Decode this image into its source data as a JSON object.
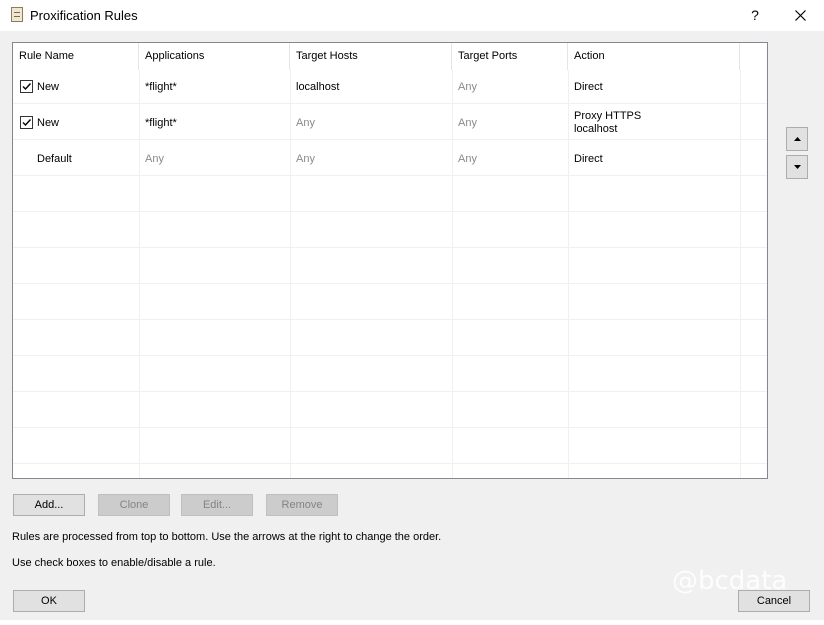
{
  "window": {
    "title": "Proxification Rules",
    "help_label": "?",
    "close_icon": "close-icon"
  },
  "table": {
    "columns": [
      "Rule Name",
      "Applications",
      "Target Hosts",
      "Target Ports",
      "Action"
    ],
    "rows": [
      {
        "checked": true,
        "name": "New",
        "applications": "*flight*",
        "target_hosts": "localhost",
        "target_ports": "Any",
        "action_line1": "Direct",
        "action_line2": ""
      },
      {
        "checked": true,
        "name": "New",
        "applications": "*flight*",
        "target_hosts": "Any",
        "target_ports": "Any",
        "action_line1": "Proxy HTTPS",
        "action_line2": "localhost"
      },
      {
        "checked": null,
        "name": "Default",
        "applications": "Any",
        "target_hosts": "Any",
        "target_ports": "Any",
        "action_line1": "Direct",
        "action_line2": ""
      }
    ]
  },
  "side_buttons": {
    "up_icon": "arrow-up-icon",
    "down_icon": "arrow-down-icon"
  },
  "buttons": {
    "add": "Add...",
    "clone": "Clone",
    "edit": "Edit...",
    "remove": "Remove",
    "ok": "OK",
    "cancel": "Cancel"
  },
  "notes": {
    "order": "Rules are processed from top to bottom. Use the arrows at the right to change the order.",
    "checkboxes": "Use check boxes to enable/disable a rule."
  },
  "watermark": "@bcdata",
  "colors": {
    "background": "#f0f0f0",
    "grey_text": "#8a8a8a",
    "disabled_button": "#cccccc"
  }
}
